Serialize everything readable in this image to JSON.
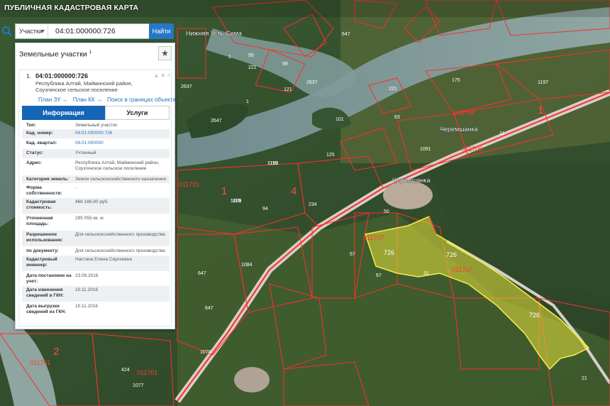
{
  "app": {
    "title": "ПУБЛИЧНАЯ КАДАСТРОВАЯ КАРТА"
  },
  "colors": {
    "boundary": "#ff2d2d",
    "selected_fill": "#e6e23a",
    "primary": "#1565b6"
  },
  "search": {
    "type_label": "Участки",
    "value": "04:01:000000:726",
    "button_label": "Найти"
  },
  "panel": {
    "title": "Земельные участки",
    "count": "1",
    "result": {
      "num": "1.",
      "cad_number": "04:01:000000:726",
      "address_lines": [
        "Республика Алтай, Майминский район,",
        "Соузгинское сельское поселение"
      ],
      "links": [
        "План ЗУ →",
        "План КК →",
        "Поиск в границах объекта →"
      ]
    },
    "tabs": {
      "info": "Информация",
      "services": "Услуги"
    },
    "rows": [
      {
        "k": "Тип:",
        "v": "Земельный участок",
        "link": false
      },
      {
        "k": "Кад. номер:",
        "v": "04:01:000000:726",
        "link": true
      },
      {
        "k": "Кад. квартал:",
        "v": "04:01:000000",
        "link": true
      },
      {
        "k": "Статус:",
        "v": "Учтенный",
        "link": false
      },
      {
        "k": "Адрес:",
        "v": "Республика Алтай, Майминский район, Соузгинское сельское поселение",
        "link": false
      },
      {
        "k": "Категория земель:",
        "v": "Земли сельскохозяйственного назначения",
        "link": false
      },
      {
        "k": "Форма собственности:",
        "v": "-",
        "link": false
      },
      {
        "k": "Кадастровая стоимость:",
        "v": "466 186,90 руб.",
        "link": false
      },
      {
        "k": "Уточненная площадь:",
        "v": "295 055 кв. м",
        "link": false
      },
      {
        "k": "Разрешенное использование:",
        "v": "Для сельскохозяйственного производства",
        "link": false
      },
      {
        "k": "по документу:",
        "v": "Для сельскохозяйственного производства",
        "link": false
      },
      {
        "k": "Кадастровый инженер:",
        "v": "Настина Елена Сергеевна",
        "link": false
      },
      {
        "k": "Дата постановки на учет:",
        "v": "23.09.2016",
        "link": false
      },
      {
        "k": "Дата изменения сведений в ГКН:",
        "v": "10.11.2016",
        "link": false
      },
      {
        "k": "Дата выгрузки сведений из ГКН:",
        "v": "10.11.2016",
        "link": false
      }
    ]
  },
  "map": {
    "villages": [
      "Нижняя Усть-Сема",
      "Черемшанка",
      "Черемшанка"
    ],
    "quarter_labels": [
      "011701",
      "011707",
      "011707",
      "011701",
      "011704",
      "011706",
      "011701"
    ],
    "big_labels": [
      "4",
      "1",
      "2",
      "1"
    ],
    "parcel_labels": [
      "647",
      "1",
      "95",
      "99",
      "1",
      "2637",
      "2647",
      "2637",
      "121",
      "221",
      "1193",
      "101",
      "125",
      "1119",
      "94",
      "234",
      "50",
      "1009",
      "1084",
      "647",
      "647",
      "57",
      "67",
      "726",
      "31",
      "726",
      "726",
      "1078",
      "424",
      "1077",
      "21",
      "1119",
      "175",
      "1197",
      "11",
      "63",
      "1091",
      "221"
    ]
  }
}
